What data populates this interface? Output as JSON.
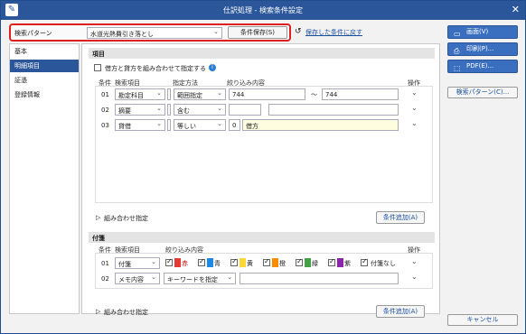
{
  "window": {
    "title": "仕訳処理 - 検索条件設定"
  },
  "search": {
    "label": "検索パターン",
    "pattern": "水道光熱費引き落とし",
    "save_button": "条件保存(S)",
    "saved_link": "保存した条件に戻す"
  },
  "nav": {
    "items": [
      "基本",
      "明細項目",
      "証憑",
      "登録情報"
    ],
    "selected": 1
  },
  "meisai": {
    "section_title": "項目",
    "combine_checkbox_label": "借方と貸方を組み合わせて指定する",
    "columns": {
      "cond": "条件",
      "item": "検索項目",
      "method": "指定方法",
      "content": "絞り込み内容",
      "op": "操作"
    },
    "rows": [
      {
        "no": "01",
        "item": "勘定科目",
        "method": "範囲指定",
        "from": "744",
        "tilde": "〜",
        "to": "744"
      },
      {
        "no": "02",
        "item": "摘要",
        "method": "含む",
        "from": "",
        "to": ""
      },
      {
        "no": "03",
        "item": "貸借",
        "method": "等しい",
        "code": "0",
        "value": "借方"
      }
    ],
    "combo_label": "組み合わせ指定",
    "add_button": "条件追加(A)"
  },
  "fusen": {
    "section_title": "付箋",
    "columns": {
      "cond": "条件",
      "item": "検索項目",
      "content": "絞り込み内容",
      "op": "操作"
    },
    "row1": {
      "no": "01",
      "item": "付箋",
      "colors": [
        {
          "label": "赤",
          "color": "#e53935"
        },
        {
          "label": "青",
          "color": "#1e88e5"
        },
        {
          "label": "黄",
          "color": "#fdd835"
        },
        {
          "label": "橙",
          "color": "#fb8c00"
        },
        {
          "label": "緑",
          "color": "#43a047"
        },
        {
          "label": "紫",
          "color": "#8e24aa"
        }
      ],
      "none_label": "付箋なし"
    },
    "row2": {
      "no": "02",
      "item": "メモ内容",
      "method": "キーワードを指定"
    },
    "combo_label": "組み合わせ指定",
    "add_button": "条件追加(A)"
  },
  "actions": {
    "screen": "画面(V)",
    "print": "印刷(P)...",
    "pdf": "PDF(E)...",
    "pattern": "検索パターン(C)...",
    "cancel": "キャンセル"
  }
}
